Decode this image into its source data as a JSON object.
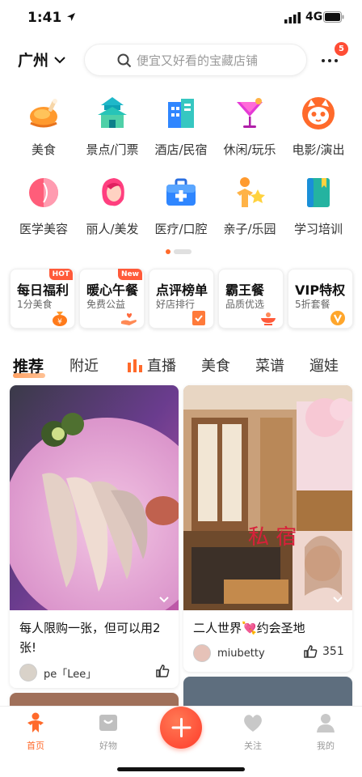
{
  "status": {
    "time": "1:41",
    "network": "4G"
  },
  "header": {
    "city": "广州",
    "search_placeholder": "便宜又好看的宝藏店铺",
    "notification_count": "5"
  },
  "categories": [
    {
      "label": "美食",
      "icon": "roast-chicken-icon"
    },
    {
      "label": "景点/门票",
      "icon": "temple-icon"
    },
    {
      "label": "酒店/民宿",
      "icon": "hotel-building-icon"
    },
    {
      "label": "休闲/玩乐",
      "icon": "cocktail-icon"
    },
    {
      "label": "电影/演出",
      "icon": "cat-mask-icon"
    },
    {
      "label": "医学美容",
      "icon": "face-icon"
    },
    {
      "label": "丽人/美发",
      "icon": "hair-icon"
    },
    {
      "label": "医疗/口腔",
      "icon": "medical-kit-icon"
    },
    {
      "label": "亲子/乐园",
      "icon": "parent-child-icon"
    },
    {
      "label": "学习培训",
      "icon": "book-icon"
    }
  ],
  "promos": [
    {
      "title": "每日福利",
      "sub": "1分美食",
      "tag": "HOT",
      "icon": "money-bag-icon"
    },
    {
      "title": "暖心午餐",
      "sub": "免费公益",
      "tag": "New",
      "icon": "heart-hand-icon"
    },
    {
      "title": "点评榜单",
      "sub": "好店排行",
      "tag": "",
      "icon": "ranking-icon"
    },
    {
      "title": "霸王餐",
      "sub": "品质优选",
      "tag": "",
      "icon": "dish-icon"
    },
    {
      "title": "VIP特权",
      "sub": "5折套餐",
      "tag": "",
      "icon": "vip-icon"
    }
  ],
  "feed_tabs": [
    "推荐",
    "附近",
    "直播",
    "美食",
    "菜谱",
    "遛娃"
  ],
  "feed": [
    {
      "caption": "每人限购一张，但可以用2张!",
      "user": "pe「Lee」",
      "likes": ""
    },
    {
      "caption": "二人世界💘约会圣地",
      "user": "miubetty",
      "likes": "351"
    },
    {
      "img_overlay": "私 宿"
    }
  ],
  "tabbar": [
    "首页",
    "好物",
    "关注",
    "我的"
  ],
  "colors": {
    "accent": "#ff6a2b",
    "badge": "#ff4d35"
  }
}
